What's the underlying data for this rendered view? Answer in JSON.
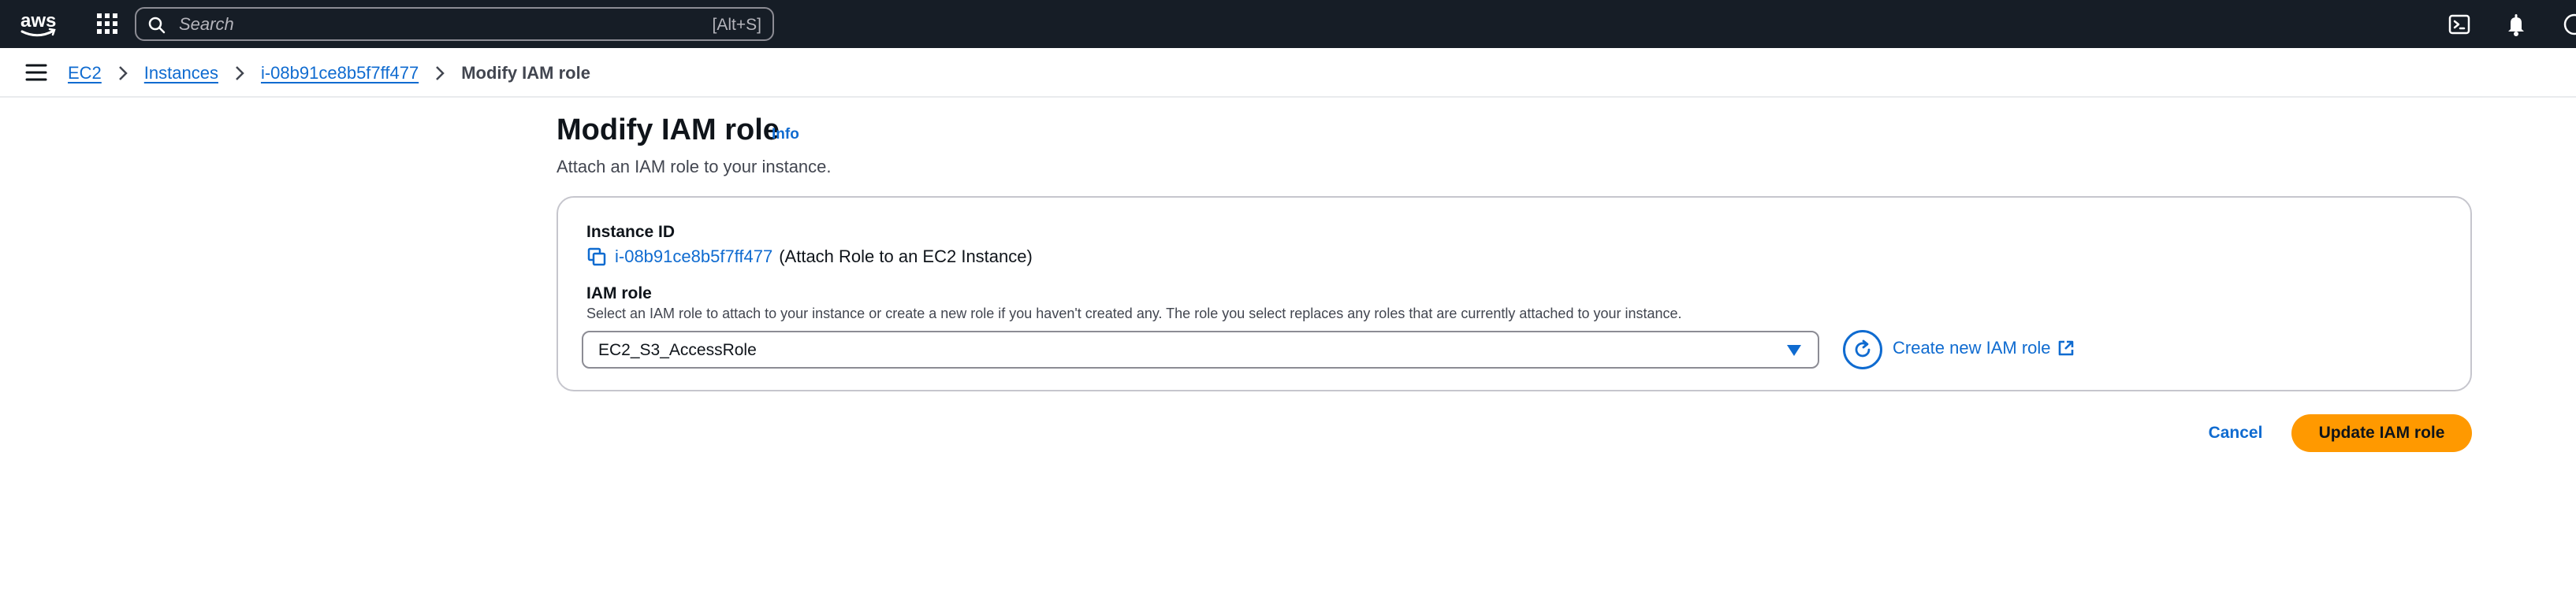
{
  "topbar": {
    "logo_text": "aws",
    "search": {
      "placeholder": "Search",
      "shortcut": "[Alt+S]"
    },
    "icons": [
      "cloudshell-icon",
      "bell-icon",
      "help-icon"
    ]
  },
  "breadcrumb": {
    "items": [
      {
        "label": "EC2"
      },
      {
        "label": "Instances"
      },
      {
        "label": "i-08b91ce8b5f7ff477"
      }
    ],
    "current": "Modify IAM role"
  },
  "page": {
    "title": "Modify IAM role",
    "info_label": "Info",
    "description": "Attach an IAM role to your instance."
  },
  "form": {
    "instance_id_label": "Instance ID",
    "instance_id_value": "i-08b91ce8b5f7ff477",
    "instance_id_suffix": "(Attach Role to an EC2 Instance)",
    "iam_role_label": "IAM role",
    "iam_role_description": "Select an IAM role to attach to your instance or create a new role if you haven't created any. The role you select replaces any roles that are currently attached to your instance.",
    "iam_role_selected": "EC2_S3_AccessRole",
    "create_role_label": "Create new IAM role"
  },
  "actions": {
    "cancel_label": "Cancel",
    "submit_label": "Update IAM role"
  },
  "colors": {
    "topbar_bg": "#161d26",
    "link": "#0f6bd0",
    "primary": "#ff9900"
  }
}
